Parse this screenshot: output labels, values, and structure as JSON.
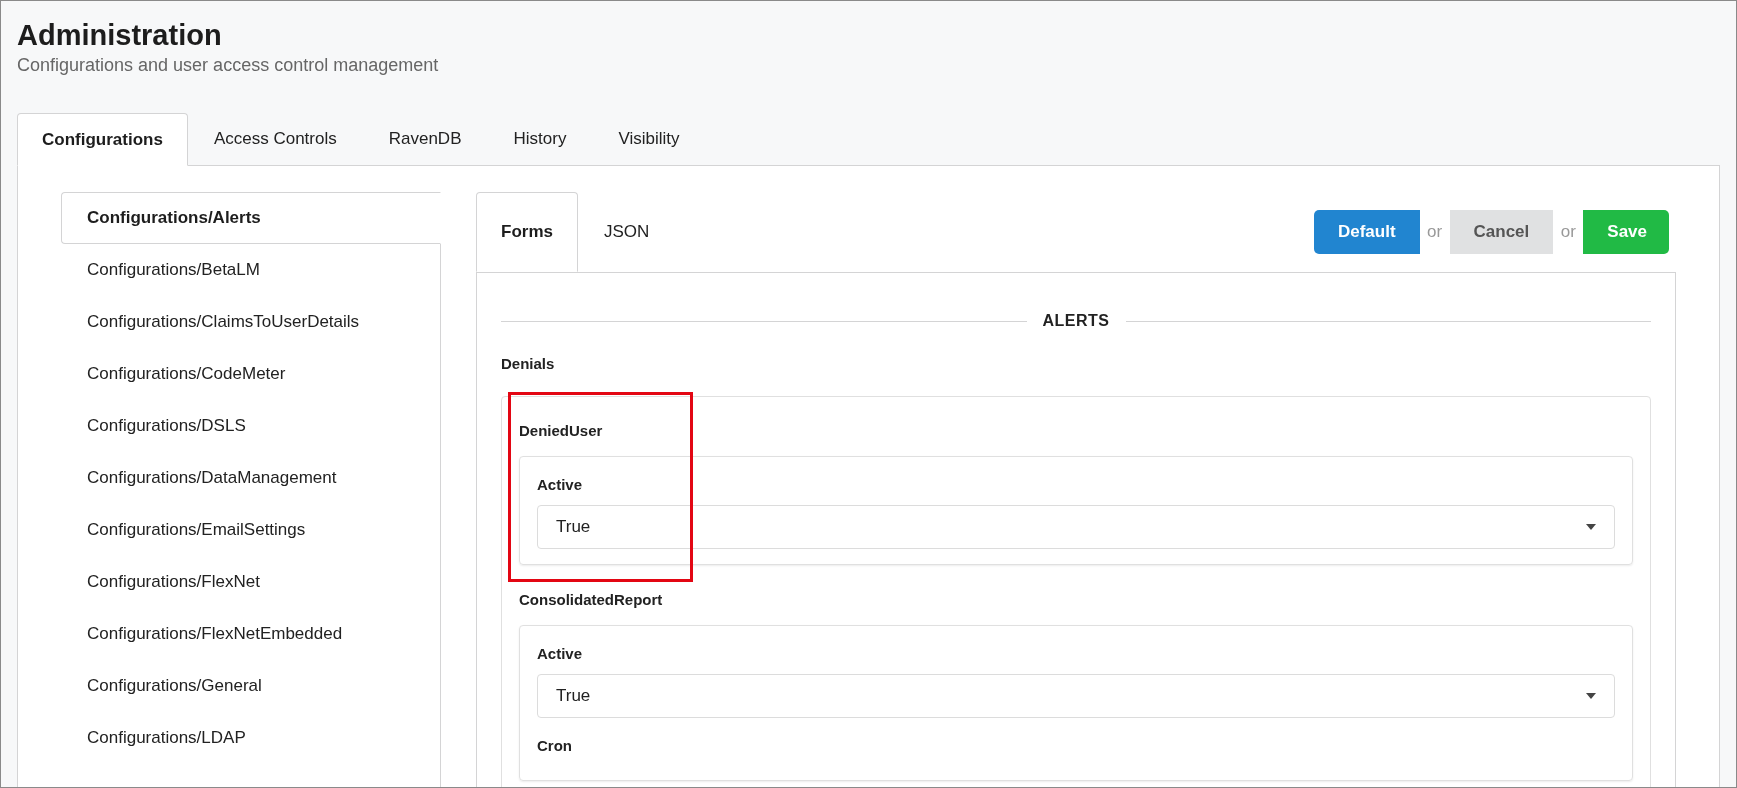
{
  "header": {
    "title": "Administration",
    "subtitle": "Configurations and user access control management"
  },
  "tabs": [
    {
      "label": "Configurations",
      "selected": true
    },
    {
      "label": "Access Controls",
      "selected": false
    },
    {
      "label": "RavenDB",
      "selected": false
    },
    {
      "label": "History",
      "selected": false
    },
    {
      "label": "Visibility",
      "selected": false
    }
  ],
  "sidebar": {
    "items": [
      {
        "label": "Configurations/Alerts",
        "selected": true
      },
      {
        "label": "Configurations/BetaLM",
        "selected": false
      },
      {
        "label": "Configurations/ClaimsToUserDetails",
        "selected": false
      },
      {
        "label": "Configurations/CodeMeter",
        "selected": false
      },
      {
        "label": "Configurations/DSLS",
        "selected": false
      },
      {
        "label": "Configurations/DataManagement",
        "selected": false
      },
      {
        "label": "Configurations/EmailSettings",
        "selected": false
      },
      {
        "label": "Configurations/FlexNet",
        "selected": false
      },
      {
        "label": "Configurations/FlexNetEmbedded",
        "selected": false
      },
      {
        "label": "Configurations/General",
        "selected": false
      },
      {
        "label": "Configurations/LDAP",
        "selected": false
      }
    ]
  },
  "editor_tabs": [
    {
      "label": "Forms",
      "selected": true
    },
    {
      "label": "JSON",
      "selected": false
    }
  ],
  "actions": [
    {
      "kind": "default",
      "label": "Default"
    },
    {
      "kind": "separator",
      "label": "or"
    },
    {
      "kind": "cancel",
      "label": "Cancel"
    },
    {
      "kind": "separator",
      "label": "or"
    },
    {
      "kind": "save",
      "label": "Save"
    }
  ],
  "form": {
    "heading": "ALERTS",
    "section": "Denials",
    "groups": [
      {
        "title": "DeniedUser",
        "highlighted": true,
        "fields": [
          {
            "kind": "select",
            "label": "Active",
            "value": "True"
          }
        ]
      },
      {
        "title": "ConsolidatedReport",
        "highlighted": false,
        "fields": [
          {
            "kind": "select",
            "label": "Active",
            "value": "True"
          },
          {
            "kind": "text",
            "label": "Cron"
          }
        ]
      }
    ]
  }
}
